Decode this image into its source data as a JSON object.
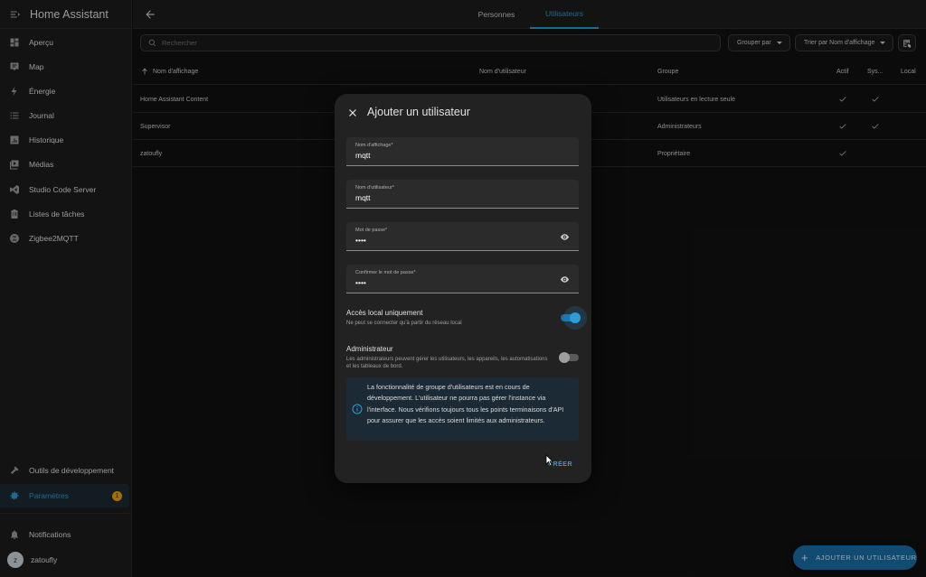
{
  "app": {
    "title": "Home Assistant"
  },
  "sidebar": {
    "items": [
      {
        "label": "Aperçu",
        "icon": "dashboard-icon"
      },
      {
        "label": "Map",
        "icon": "map-icon"
      },
      {
        "label": "Énergie",
        "icon": "lightning-icon"
      },
      {
        "label": "Journal",
        "icon": "list-icon"
      },
      {
        "label": "Historique",
        "icon": "chart-icon"
      },
      {
        "label": "Médias",
        "icon": "media-icon"
      },
      {
        "label": "Studio Code Server",
        "icon": "vscode-icon"
      },
      {
        "label": "Listes de tâches",
        "icon": "clipboard-icon"
      },
      {
        "label": "Zigbee2MQTT",
        "icon": "zigbee-icon"
      }
    ],
    "dev_tools": "Outils de développement",
    "settings": "Paramètres",
    "settings_badge": "1",
    "notifications": "Notifications",
    "user": {
      "name": "zatoufly",
      "initial": "z"
    }
  },
  "tabs": [
    {
      "label": "Personnes",
      "active": false
    },
    {
      "label": "Utilisateurs",
      "active": true
    }
  ],
  "toolbar": {
    "search_placeholder": "Rechercher",
    "group_by": "Grouper par",
    "sort_by": "Trier par Nom d'affichage"
  },
  "table": {
    "headers": {
      "display_name": "Nom d'affichage",
      "username": "Nom d'utilisateur",
      "group": "Groupe",
      "active": "Actif",
      "system": "Sys...",
      "local": "Local"
    },
    "rows": [
      {
        "display_name": "Home Assistant Content",
        "username": "",
        "group": "Utilisateurs en lecture seule",
        "active": true,
        "system": true,
        "local": false
      },
      {
        "display_name": "Supervisor",
        "username": "",
        "group": "Administrateurs",
        "active": true,
        "system": true,
        "local": false
      },
      {
        "display_name": "zatoufly",
        "username": "",
        "group": "Propriétaire",
        "active": true,
        "system": false,
        "local": false
      }
    ]
  },
  "dialog": {
    "title": "Ajouter un utilisateur",
    "fields": {
      "display_name": {
        "label": "Nom d'affichage*",
        "value": "mqtt"
      },
      "username": {
        "label": "Nom d'utilisateur*",
        "value": "mqtt"
      },
      "password": {
        "label": "Mot de passe*",
        "value": "••••"
      },
      "confirm_password": {
        "label": "Confirmer le mot de passe*",
        "value": "••••"
      }
    },
    "local_access": {
      "title": "Accès local uniquement",
      "description": "Ne peut se connecter qu'à partir du réseau local",
      "enabled": true
    },
    "admin": {
      "title": "Administrateur",
      "description": "Les administrateurs peuvent gérer les utilisateurs, les appareils, les automatisations et les tableaux de bord.",
      "enabled": false
    },
    "info_text": "La fonctionnalité de groupe d'utilisateurs est en cours de développement. L'utilisateur ne pourra pas gérer l'instance via l'interface. Nous vérifions toujours tous les points terminaisons d'API pour assurer que les accès soient limités aux administrateurs.",
    "create_label": "CRÉER"
  },
  "fab": {
    "label": "AJOUTER UN UTILISATEUR"
  },
  "colors": {
    "accent": "#2d9cdb",
    "background": "#111111",
    "surface": "#1c1c1c",
    "dialog": "#222222",
    "badge": "#f0a500"
  }
}
